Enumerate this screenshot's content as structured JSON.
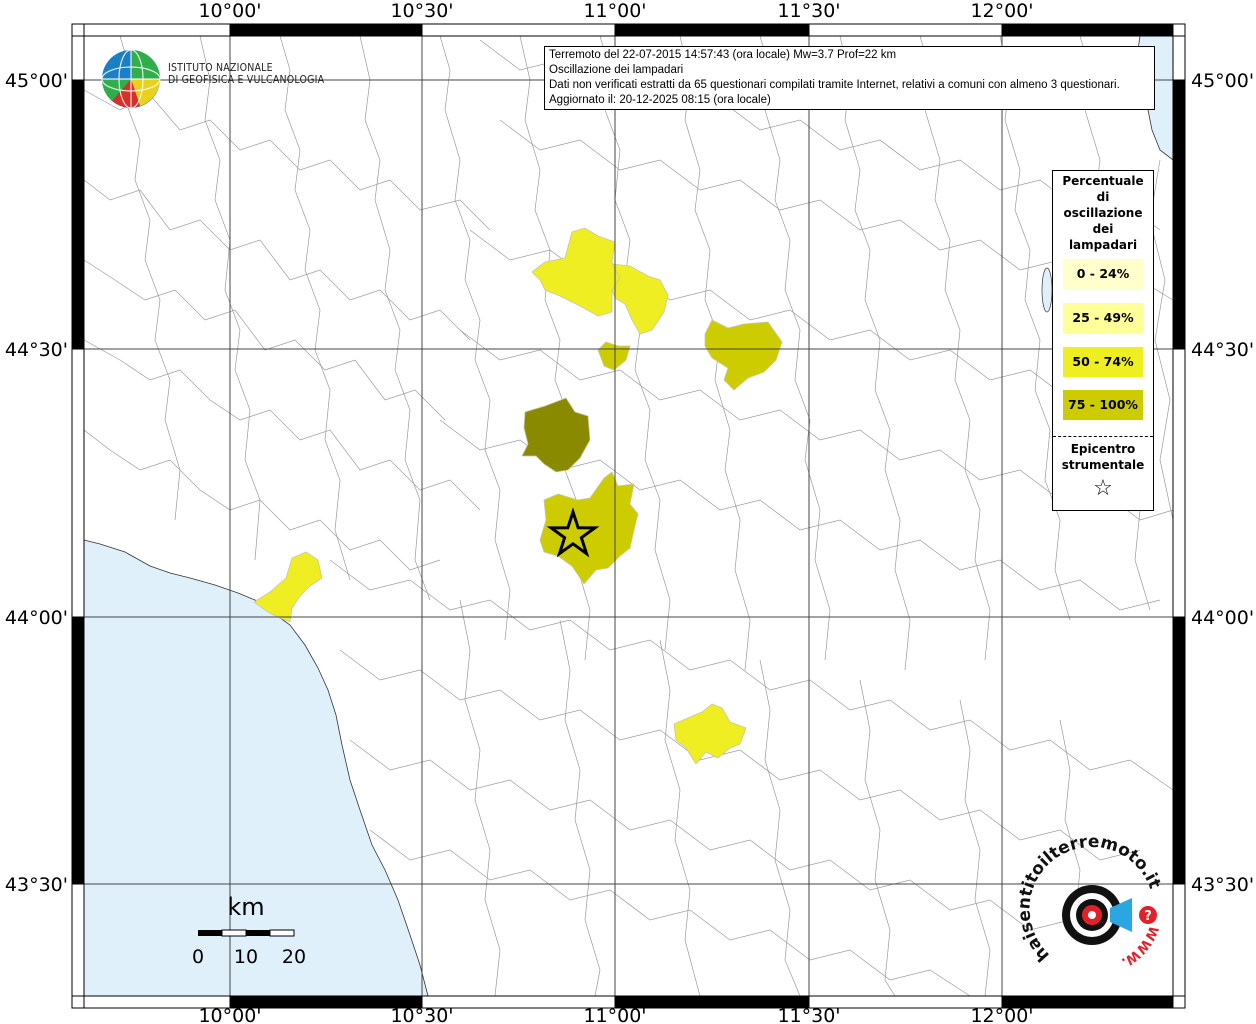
{
  "info": {
    "line1": "Terremoto del 22-07-2015 14:57:43 (ora locale) Mw=3.7 Prof=22 km",
    "line2": "Oscillazione dei lampadari",
    "line3": "Dati non verificati estratti da 65 questionari compilati tramite Internet, relativi a comuni con almeno 3 questionari.",
    "line4": "Aggiornato il: 20-12-2025 08:15 (ora locale)"
  },
  "logo": {
    "line1": "ISTITUTO NAZIONALE",
    "line2": "DI GEOFISICA E VULCANOLOGIA"
  },
  "axes": {
    "top_labels": [
      "10°00'",
      "10°30'",
      "11°00'",
      "11°30'",
      "12°00'"
    ],
    "bottom_labels": [
      "10°00'",
      "10°30'",
      "11°00'",
      "11°30'",
      "12°00'"
    ],
    "left_labels": [
      "45°00'",
      "44°30'",
      "44°00'",
      "43°30'"
    ],
    "right_labels": [
      "45°00'",
      "44°30'",
      "44°00'",
      "43°30'"
    ]
  },
  "legend": {
    "title_line1": "Percentuale",
    "title_line2": "di",
    "title_line3": "oscillazione",
    "title_line4": "dei",
    "title_line5": "lampadari",
    "items": [
      {
        "label": "0 - 24%",
        "color": "#ffffcc"
      },
      {
        "label": "25 - 49%",
        "color": "#ffff99"
      },
      {
        "label": "50 - 74%",
        "color": "#eeee22"
      },
      {
        "label": "75 - 100%",
        "color": "#cccc00"
      }
    ],
    "epicentro_line1": "Epicentro",
    "epicentro_line2": "strumentale"
  },
  "scale": {
    "unit": "km",
    "labels": [
      "0",
      "10",
      "20"
    ]
  },
  "colors": {
    "sea": "#dff0fb",
    "level_50_74": "#eeee22",
    "level_75_100": "#cccc00",
    "level_dark": "#8a8a00"
  },
  "watermark": {
    "text": "haisentitoilterremoto.it",
    "url": "WWW.",
    "question": "?"
  }
}
